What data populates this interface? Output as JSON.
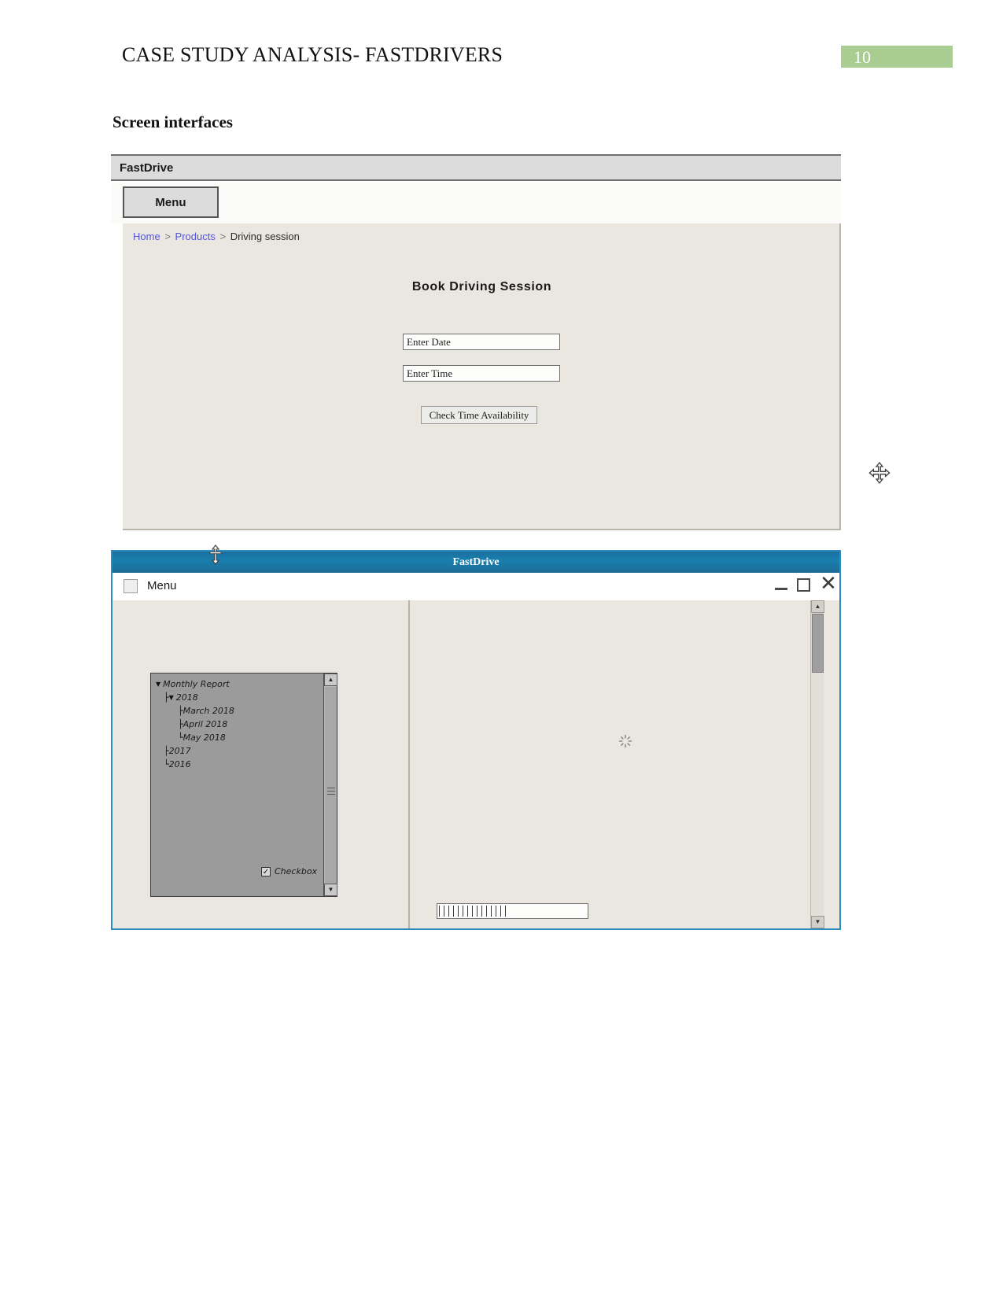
{
  "document": {
    "header_title": "CASE STUDY ANALYSIS- FASTDRIVERS",
    "page_number": "10",
    "page_number_bg": "#a9cd90",
    "section_heading": "Screen interfaces"
  },
  "mockup1": {
    "titlebar": {
      "title": "FastDrive"
    },
    "menu_button": {
      "label": "Menu"
    },
    "breadcrumb": {
      "items": [
        {
          "label": "Home",
          "type": "link"
        },
        {
          "label": "Products",
          "type": "link"
        },
        {
          "label": "Driving session",
          "type": "current"
        }
      ],
      "separator": ">",
      "link_color": "#5555dd"
    },
    "form": {
      "title": "Book Driving Session",
      "date_field": {
        "value": "Enter Date",
        "placeholder": "Enter Date"
      },
      "time_field": {
        "value": "Enter Time",
        "placeholder": "Enter Time"
      },
      "submit_button": {
        "label": "Check Time Availability"
      }
    },
    "cursor": {
      "icon": "move-cursor-icon"
    }
  },
  "mockup2": {
    "titlebar": {
      "title": "FastDrive",
      "bg_color": "#1a7fae"
    },
    "resize_cursor": {
      "icon": "resize-vertical-cursor-icon"
    },
    "menubar": {
      "menu_label": "Menu",
      "window_controls": {
        "minimize": "minimize-icon",
        "maximize": "maximize-icon",
        "close": "close-icon"
      }
    },
    "tree": {
      "nodes": [
        {
          "label": "Monthly Report",
          "level": 0,
          "expanded": true
        },
        {
          "label": "2018",
          "level": 1,
          "expanded": true
        },
        {
          "label": "March 2018",
          "level": 2,
          "expanded": false
        },
        {
          "label": "April 2018",
          "level": 2,
          "expanded": false
        },
        {
          "label": "May 2018",
          "level": 2,
          "expanded": false
        },
        {
          "label": "2017",
          "level": 1,
          "expanded": false
        },
        {
          "label": "2016",
          "level": 1,
          "expanded": false
        }
      ],
      "checkbox": {
        "label": "Checkbox",
        "checked": true,
        "mark": "✓"
      },
      "bg_color": "#9b9b9b"
    },
    "right_panel": {
      "spinner": "loading-spinner-icon",
      "progress_field": {
        "value": ""
      }
    },
    "scroll": {
      "up_arrow": "▲",
      "down_arrow": "▼"
    }
  }
}
